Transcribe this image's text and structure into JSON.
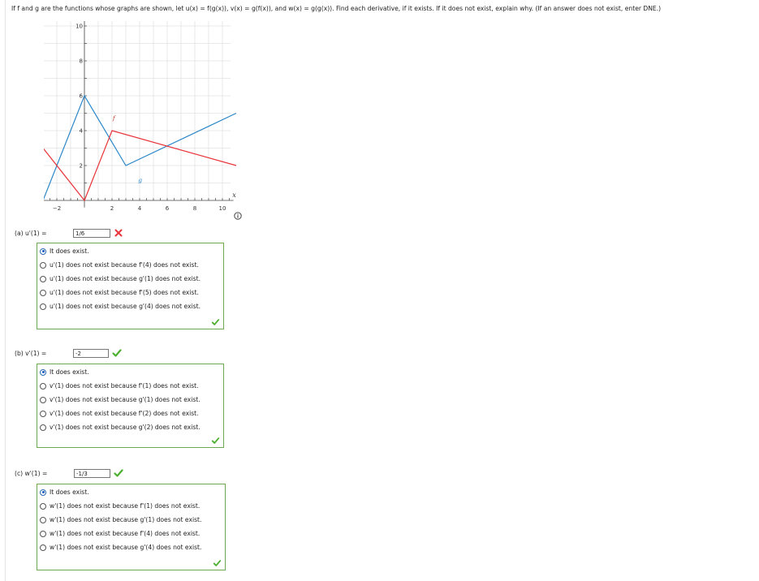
{
  "question": {
    "text": "If f and g are the functions whose graphs are shown, let u(x) = f(g(x)), v(x) = g(f(x)), and w(x) = g(g(x)). Find each derivative, if it exists. If it does not exist, explain why. (If an answer does not exist, enter DNE.)"
  },
  "graph": {
    "y_axis_label": "y",
    "x_axis_label": "x",
    "x_ticks": [
      "-2",
      "2",
      "4",
      "6",
      "8",
      "10"
    ],
    "y_ticks": [
      "2",
      "4",
      "6",
      "8",
      "10"
    ],
    "f_label": "f",
    "g_label": "g",
    "f_color": "#e8343a",
    "g_color": "#2b87c8",
    "f_points": [
      [
        -3,
        3
      ],
      [
        0,
        0
      ],
      [
        2,
        4
      ],
      [
        11,
        2
      ]
    ],
    "g_points": [
      [
        -3,
        0
      ],
      [
        0,
        6
      ],
      [
        3,
        2
      ],
      [
        11,
        5
      ]
    ]
  },
  "parts": [
    {
      "label": "(a)  u'(1) =",
      "answer": "1/6",
      "status": "incorrect",
      "options": [
        {
          "text": "It does exist.",
          "selected": true
        },
        {
          "text": "u'(1) does not exist because f'(4) does not exist.",
          "selected": false
        },
        {
          "text": "u'(1) does not exist because g'(1) does not exist.",
          "selected": false
        },
        {
          "text": "u'(1) does not exist because f'(5) does not exist.",
          "selected": false
        },
        {
          "text": "u'(1) does not exist because g'(4) does not exist.",
          "selected": false
        }
      ]
    },
    {
      "label": "(b)  v'(1) =",
      "answer": "-2",
      "status": "correct",
      "options": [
        {
          "text": "It does exist.",
          "selected": true
        },
        {
          "text": "v'(1) does not exist because f'(1) does not exist.",
          "selected": false
        },
        {
          "text": "v'(1) does not exist because g'(1) does not exist.",
          "selected": false
        },
        {
          "text": "v'(1) does not exist because f'(2) does not exist.",
          "selected": false
        },
        {
          "text": "v'(1) does not exist because g'(2) does not exist.",
          "selected": false
        }
      ]
    },
    {
      "label": "(c)  w'(1) =",
      "answer": "-1/3",
      "status": "correct",
      "options": [
        {
          "text": "It does exist.",
          "selected": true
        },
        {
          "text": "w'(1) does not exist because f'(1) does not exist.",
          "selected": false
        },
        {
          "text": "w'(1) does not exist because g'(1) does not exist.",
          "selected": false
        },
        {
          "text": "w'(1) does not exist because f'(4) does not exist.",
          "selected": false
        },
        {
          "text": "w'(1) does not exist because g'(4) does not exist.",
          "selected": false
        }
      ]
    }
  ],
  "colors": {
    "correct": "#4caf2f",
    "incorrect": "#e8343a",
    "box_border": "#6ba84f"
  }
}
